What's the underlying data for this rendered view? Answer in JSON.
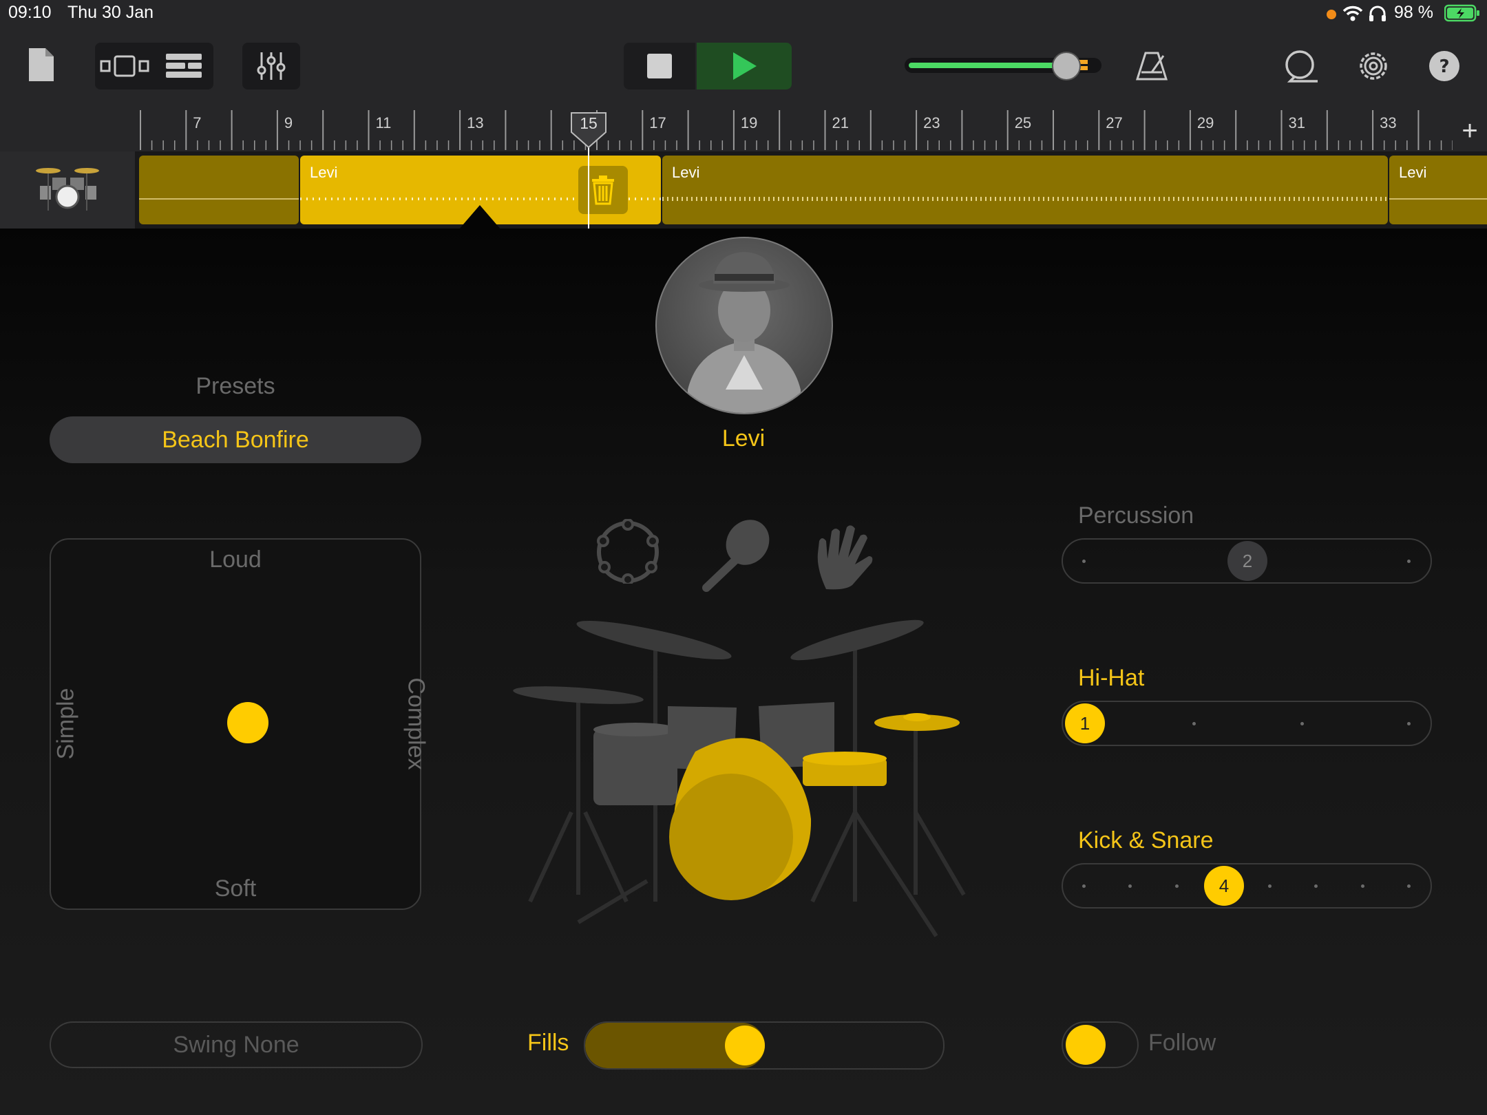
{
  "status": {
    "time": "09:10",
    "date": "Thu 30 Jan",
    "battery": "98 %"
  },
  "toolbar": {
    "document_icon": "document-icon",
    "view_icon": "track-view-icon",
    "tracks_icon": "tracks-list-icon",
    "mixer_icon": "mixer-icon",
    "stop_icon": "stop-icon",
    "play_icon": "play-icon",
    "metronome_icon": "metronome-icon",
    "loop_icon": "loop-icon",
    "settings_icon": "settings-icon",
    "help_icon": "help-icon",
    "master_volume": 0.82
  },
  "ruler": {
    "bars": [
      "7",
      "9",
      "11",
      "13",
      "15",
      "17",
      "19",
      "21",
      "23",
      "25",
      "27",
      "29",
      "31",
      "33"
    ],
    "playhead_bar": "15",
    "add_label": "+"
  },
  "track": {
    "regions": [
      {
        "label": ""
      },
      {
        "label": "Levi"
      },
      {
        "label": "Levi"
      },
      {
        "label": "Levi"
      }
    ]
  },
  "drummer": {
    "name": "Levi"
  },
  "presets": {
    "heading": "Presets",
    "selected": "Beach Bonfire"
  },
  "xy_pad": {
    "top": "Loud",
    "bottom": "Soft",
    "left": "Simple",
    "right": "Complex"
  },
  "swing": {
    "label": "Swing None"
  },
  "fills": {
    "label": "Fills",
    "value": 0.44
  },
  "follow": {
    "label": "Follow"
  },
  "percussion": {
    "label": "Percussion",
    "value": "2"
  },
  "hihat": {
    "label": "Hi-Hat",
    "value": "1"
  },
  "kick_snare": {
    "label": "Kick & Snare",
    "value": "4"
  },
  "colors": {
    "accent": "#f5c518",
    "region": "#8a7200",
    "region_selected": "#e6b800",
    "play": "#1f4d22"
  }
}
